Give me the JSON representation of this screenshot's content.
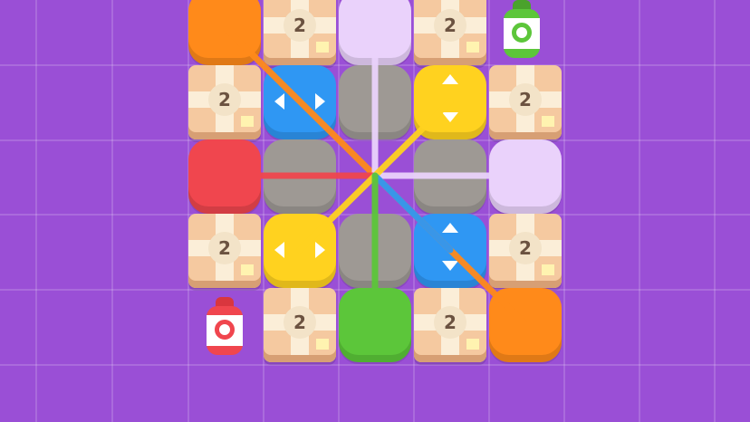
{
  "board": {
    "tiles": [
      {
        "kind": "color",
        "color": "#ff8a1a",
        "col": 0,
        "row": 0
      },
      {
        "kind": "box",
        "count": "2",
        "col": 1,
        "row": 0
      },
      {
        "kind": "color",
        "color": "#ead2fb",
        "col": 2,
        "row": 0
      },
      {
        "kind": "box",
        "count": "2",
        "col": 3,
        "row": 0
      },
      {
        "kind": "box",
        "count": "2",
        "col": 0,
        "row": 1
      },
      {
        "kind": "color",
        "color": "#2f97f3",
        "col": 1,
        "row": 1,
        "arrows": "horizontal"
      },
      {
        "kind": "color",
        "color": "#9e9994",
        "col": 2,
        "row": 1
      },
      {
        "kind": "color",
        "color": "#ffd21f",
        "col": 3,
        "row": 1,
        "arrows": "vertical"
      },
      {
        "kind": "box",
        "count": "2",
        "col": 4,
        "row": 1
      },
      {
        "kind": "color",
        "color": "#f0464e",
        "col": 0,
        "row": 2
      },
      {
        "kind": "color",
        "color": "#9e9994",
        "col": 1,
        "row": 2
      },
      {
        "kind": "color",
        "color": "#9e9994",
        "col": 3,
        "row": 2
      },
      {
        "kind": "color",
        "color": "#ead2fb",
        "col": 4,
        "row": 2
      },
      {
        "kind": "box",
        "count": "2",
        "col": 0,
        "row": 3
      },
      {
        "kind": "color",
        "color": "#ffd21f",
        "col": 1,
        "row": 3,
        "arrows": "horizontal"
      },
      {
        "kind": "color",
        "color": "#9e9994",
        "col": 2,
        "row": 3
      },
      {
        "kind": "color",
        "color": "#2f97f3",
        "col": 3,
        "row": 3,
        "arrows": "vertical"
      },
      {
        "kind": "box",
        "count": "2",
        "col": 4,
        "row": 3
      },
      {
        "kind": "box",
        "count": "2",
        "col": 1,
        "row": 4
      },
      {
        "kind": "color",
        "color": "#5cc63a",
        "col": 2,
        "row": 4
      },
      {
        "kind": "box",
        "count": "2",
        "col": 3,
        "row": 4
      },
      {
        "kind": "color",
        "color": "#ff8a1a",
        "col": 4,
        "row": 4
      }
    ],
    "lines": [
      {
        "color": "#ff8a1a",
        "from": [
          0,
          0
        ],
        "to": [
          4,
          4
        ]
      },
      {
        "color": "#ead2fb",
        "from": [
          2,
          0
        ],
        "to": [
          2,
          2
        ]
      },
      {
        "color": "#ead2fb",
        "from": [
          2,
          2
        ],
        "to": [
          4,
          2
        ]
      },
      {
        "color": "#f0464e",
        "from": [
          0,
          2
        ],
        "to": [
          2,
          2
        ]
      },
      {
        "color": "#ffd21f",
        "from": [
          3,
          1
        ],
        "to": [
          1,
          3
        ]
      },
      {
        "color": "#2f97f3",
        "from": [
          2,
          2
        ],
        "to": [
          3,
          3
        ]
      },
      {
        "color": "#5cc63a",
        "from": [
          2,
          2
        ],
        "to": [
          2,
          4
        ]
      }
    ]
  },
  "sprays": [
    {
      "name": "green-spray-can",
      "color": "#5cc63a",
      "cap": "#4aa22c",
      "anchor": "top-right"
    },
    {
      "name": "red-spray-can",
      "color": "#f0464e",
      "cap": "#d9363e",
      "anchor": "bottom-left"
    }
  ]
}
